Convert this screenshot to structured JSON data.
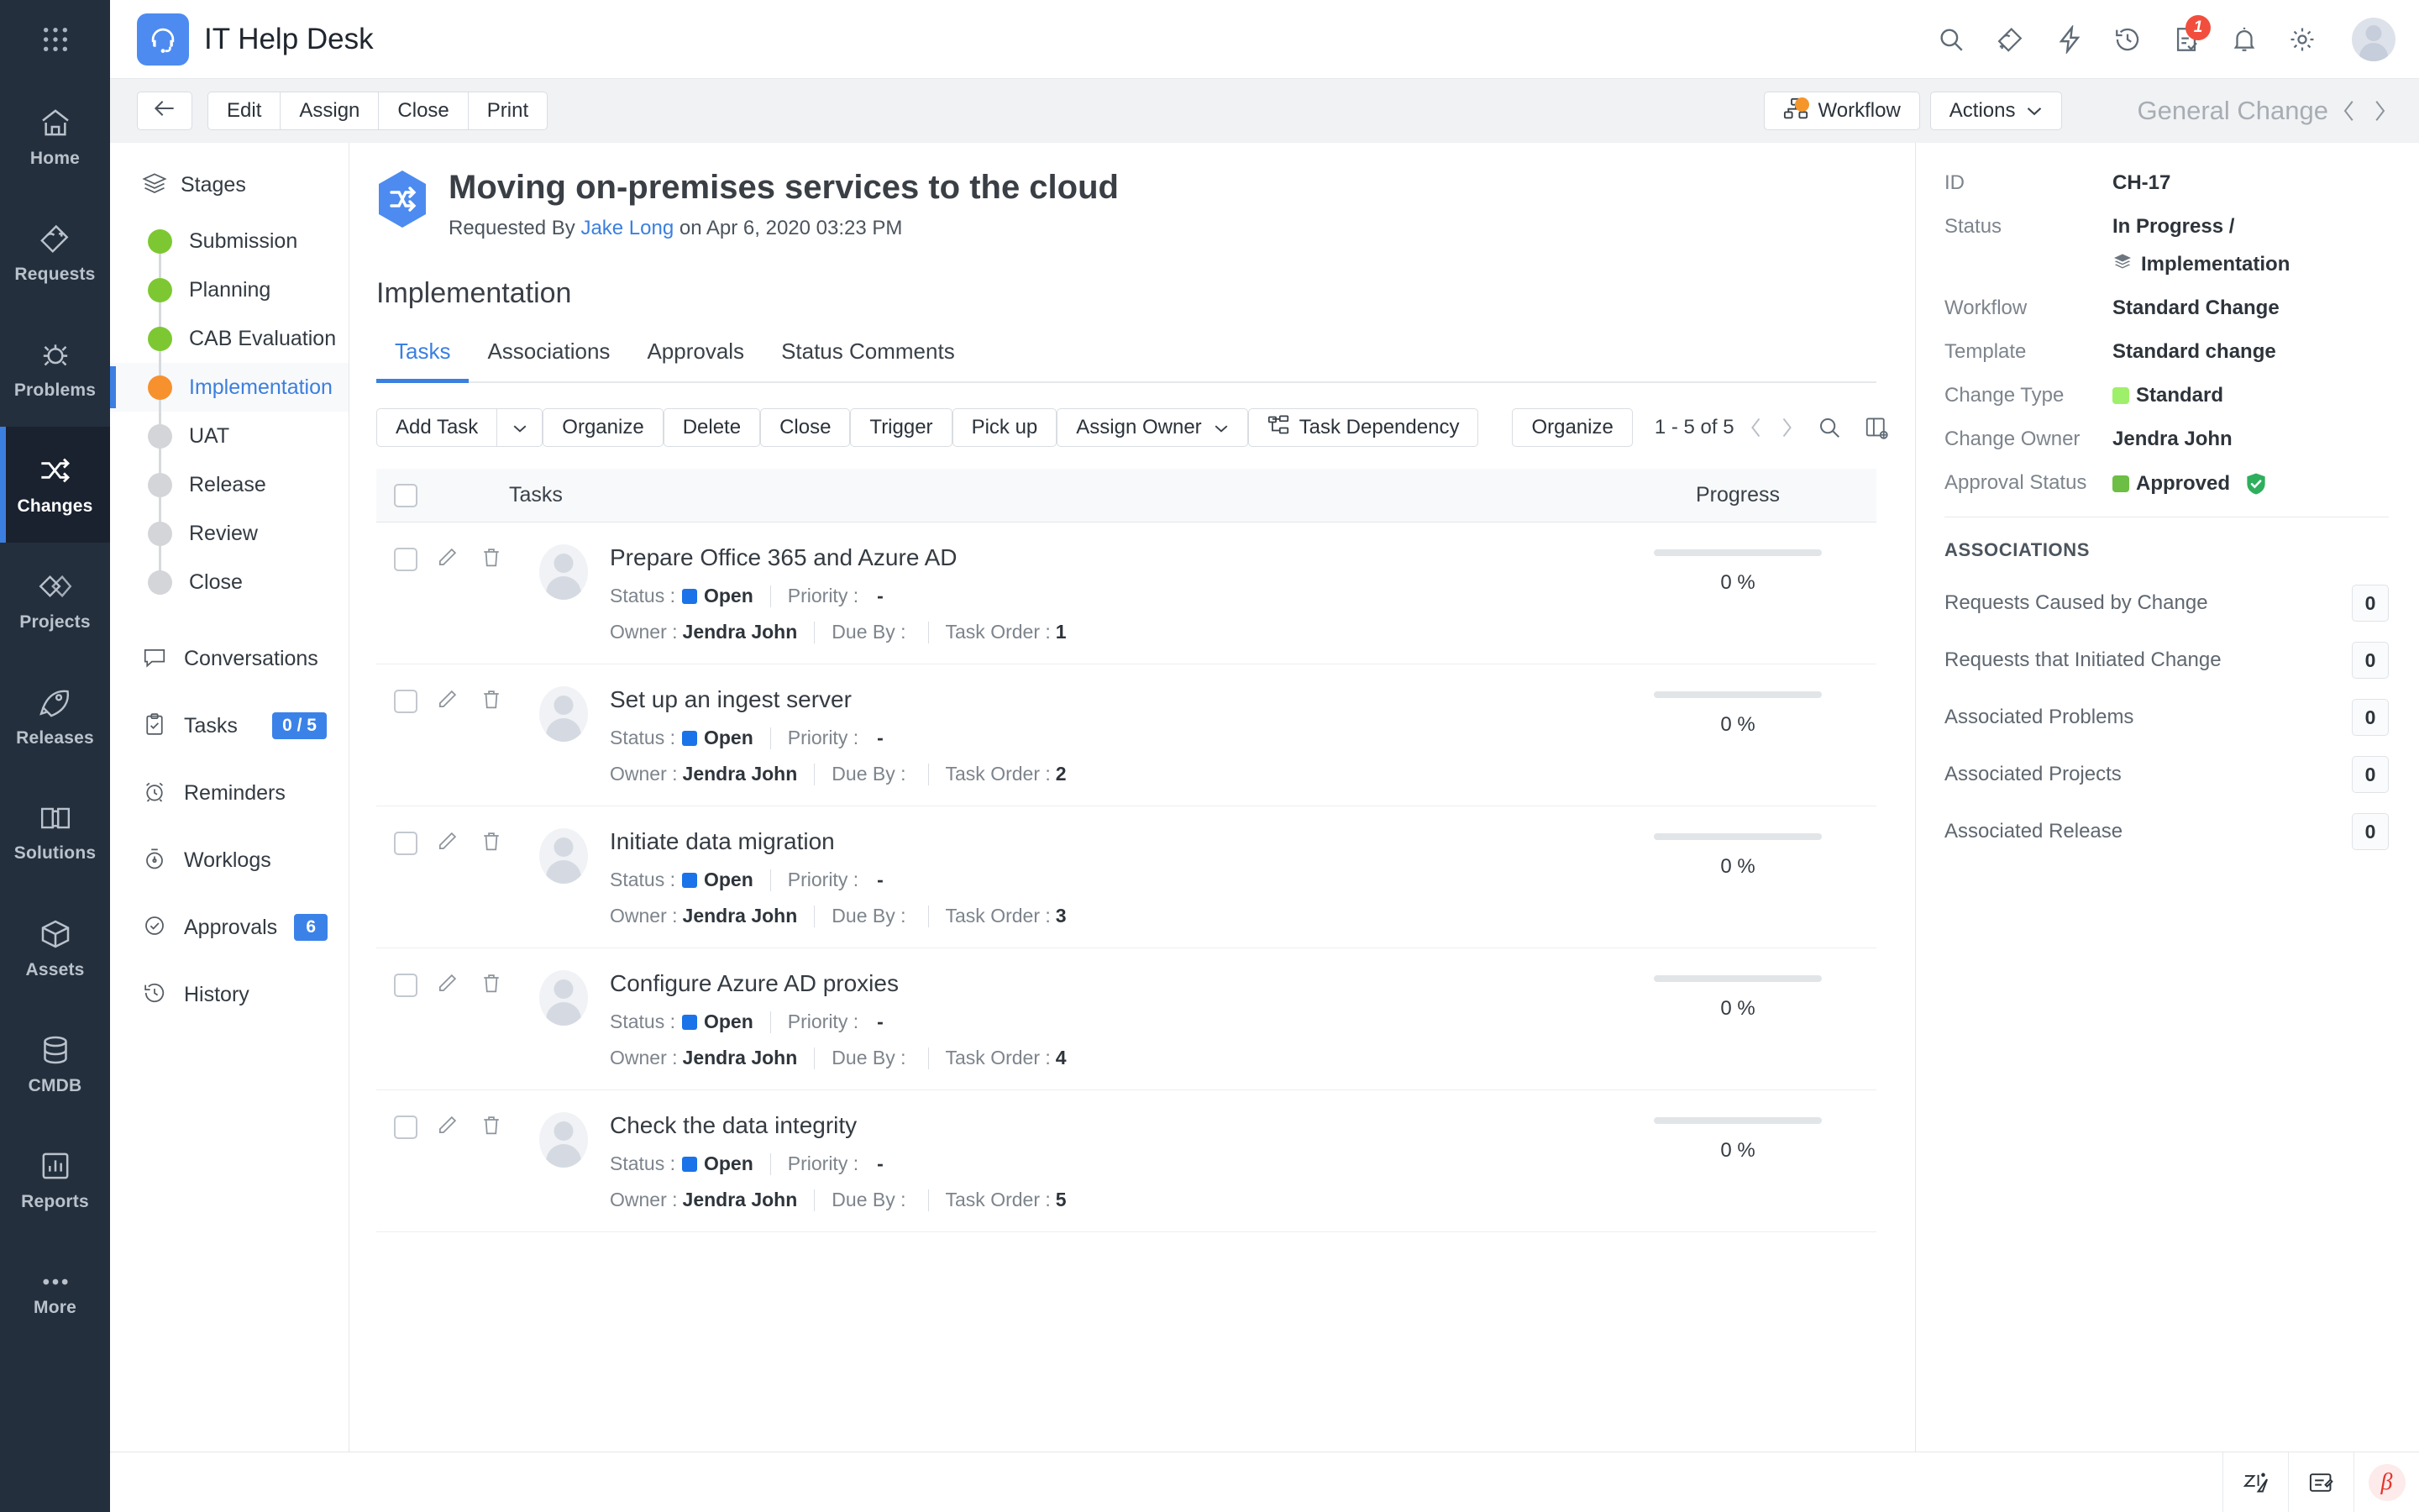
{
  "colors": {
    "accent": "#3b7fe0",
    "rail_bg": "#242f3d",
    "stage_done": "#7dc832",
    "stage_active": "#f6912e",
    "stage_pending": "#d3d5d8",
    "badge_blue": "#3b82e8",
    "badge_red": "#f24e3e",
    "status_open": "#1a73e8",
    "change_type": "#9ef06a",
    "approval": "#6cbe45"
  },
  "rail": {
    "apps_icon": "grid-apps-icon",
    "items": [
      {
        "label": "Home",
        "icon": "home-icon",
        "active": false
      },
      {
        "label": "Requests",
        "icon": "ticket-icon",
        "active": false
      },
      {
        "label": "Problems",
        "icon": "bug-icon",
        "active": false
      },
      {
        "label": "Changes",
        "icon": "changes-icon",
        "active": true
      },
      {
        "label": "Projects",
        "icon": "projects-icon",
        "active": false
      },
      {
        "label": "Releases",
        "icon": "rocket-icon",
        "active": false
      },
      {
        "label": "Solutions",
        "icon": "book-icon",
        "active": false
      },
      {
        "label": "Assets",
        "icon": "cube-icon",
        "active": false
      },
      {
        "label": "CMDB",
        "icon": "database-icon",
        "active": false
      },
      {
        "label": "Reports",
        "icon": "chart-icon",
        "active": false
      },
      {
        "label": "More",
        "icon": "ellipsis-icon",
        "active": false
      }
    ]
  },
  "topbar": {
    "title": "IT Help Desk",
    "logo_icon": "headset-icon",
    "icons": [
      {
        "name": "search-icon",
        "badge": null
      },
      {
        "name": "add-ticket-icon",
        "badge": null
      },
      {
        "name": "quick-actions-icon",
        "badge": null
      },
      {
        "name": "history-icon",
        "badge": null
      },
      {
        "name": "approvals-icon",
        "badge": "1"
      },
      {
        "name": "notifications-bell-icon",
        "badge": null
      },
      {
        "name": "settings-gear-icon",
        "badge": null
      }
    ],
    "avatar": "user-avatar"
  },
  "actionbar": {
    "back_icon": "arrow-left-icon",
    "buttons": [
      "Edit",
      "Assign",
      "Close",
      "Print"
    ],
    "workflow_label": "Workflow",
    "workflow_icon": "workflow-icon",
    "actions_label": "Actions",
    "record_type": "General Change",
    "prev_icon": "chevron-left-icon",
    "next_icon": "chevron-right-icon"
  },
  "detail_panel": {
    "stages_header": "Stages",
    "stages_icon": "layers-icon",
    "stages": [
      {
        "label": "Submission",
        "state": "done"
      },
      {
        "label": "Planning",
        "state": "done"
      },
      {
        "label": "CAB Evaluation",
        "state": "done"
      },
      {
        "label": "Implementation",
        "state": "active"
      },
      {
        "label": "UAT",
        "state": "pending"
      },
      {
        "label": "Release",
        "state": "pending"
      },
      {
        "label": "Review",
        "state": "pending"
      },
      {
        "label": "Close",
        "state": "pending"
      }
    ],
    "items": [
      {
        "label": "Conversations",
        "icon": "chat-icon",
        "badge": null
      },
      {
        "label": "Tasks",
        "icon": "clipboard-check-icon",
        "badge": "0 / 5"
      },
      {
        "label": "Reminders",
        "icon": "alarm-clock-icon",
        "badge": null
      },
      {
        "label": "Worklogs",
        "icon": "stopwatch-icon",
        "badge": null
      },
      {
        "label": "Approvals",
        "icon": "check-circle-icon",
        "badge": "6"
      },
      {
        "label": "History",
        "icon": "history-icon",
        "badge": null
      }
    ]
  },
  "record": {
    "icon": "change-hex-icon",
    "title": "Moving on-premises services to the cloud",
    "requested_by_prefix": "Requested By",
    "requester": "Jake Long",
    "requested_on": "on Apr 6, 2020 03:23 PM",
    "stage_title": "Implementation"
  },
  "tabs": [
    {
      "label": "Tasks",
      "active": true
    },
    {
      "label": "Associations",
      "active": false
    },
    {
      "label": "Approvals",
      "active": false
    },
    {
      "label": "Status Comments",
      "active": false
    }
  ],
  "toolbar": {
    "add_task_label": "Add Task",
    "add_task_caret_icon": "chevron-down-icon",
    "organize_label": "Organize",
    "delete_label": "Delete",
    "close_label": "Close",
    "trigger_label": "Trigger",
    "pickup_label": "Pick up",
    "assign_owner_label": "Assign Owner",
    "assign_owner_caret_icon": "chevron-down-icon",
    "task_dependency_label": "Task Dependency",
    "task_dependency_icon": "dependency-icon",
    "organize2_label": "Organize",
    "pager_text": "1 - 5 of 5",
    "prev_icon": "chevron-left-icon",
    "next_icon": "chevron-right-icon",
    "search_icon": "search-icon",
    "columns_icon": "column-settings-icon"
  },
  "table": {
    "header": {
      "tasks": "Tasks",
      "progress": "Progress"
    },
    "labels": {
      "status": "Status :",
      "priority": "Priority :",
      "owner": "Owner :",
      "due_by": "Due By :",
      "task_order": "Task Order :"
    },
    "rows": [
      {
        "name": "Prepare Office 365 and Azure AD",
        "status": "Open",
        "priority": "-",
        "owner": "Jendra John",
        "due_by": "",
        "task_order": "1",
        "progress": "0 %",
        "progress_value": 0
      },
      {
        "name": "Set up an ingest server",
        "status": "Open",
        "priority": "-",
        "owner": "Jendra John",
        "due_by": "",
        "task_order": "2",
        "progress": "0 %",
        "progress_value": 0
      },
      {
        "name": "Initiate data migration",
        "status": "Open",
        "priority": "-",
        "owner": "Jendra John",
        "due_by": "",
        "task_order": "3",
        "progress": "0 %",
        "progress_value": 0
      },
      {
        "name": "Configure Azure AD proxies",
        "status": "Open",
        "priority": "-",
        "owner": "Jendra John",
        "due_by": "",
        "task_order": "4",
        "progress": "0 %",
        "progress_value": 0
      },
      {
        "name": "Check the data integrity",
        "status": "Open",
        "priority": "-",
        "owner": "Jendra John",
        "due_by": "",
        "task_order": "5",
        "progress": "0 %",
        "progress_value": 0
      }
    ]
  },
  "properties": {
    "id_label": "ID",
    "id_value": "CH-17",
    "status_label": "Status",
    "status_value": "In Progress /",
    "status_stage": "Implementation",
    "workflow_label": "Workflow",
    "workflow_value": "Standard Change",
    "template_label": "Template",
    "template_value": "Standard change",
    "change_type_label": "Change Type",
    "change_type_value": "Standard",
    "change_owner_label": "Change Owner",
    "change_owner_value": "Jendra John",
    "approval_status_label": "Approval Status",
    "approval_status_value": "Approved"
  },
  "associations": {
    "title": "ASSOCIATIONS",
    "collapse_icon": "chevron-double-right-icon",
    "rows": [
      {
        "label": "Requests Caused by Change",
        "count": "0"
      },
      {
        "label": "Requests that Initiated Change",
        "count": "0"
      },
      {
        "label": "Associated Problems",
        "count": "0"
      },
      {
        "label": "Associated Projects",
        "count": "0"
      },
      {
        "label": "Associated Release",
        "count": "0"
      }
    ]
  },
  "bottombar": {
    "icons": [
      {
        "name": "zia-assistant-icon"
      },
      {
        "name": "notes-edit-icon"
      },
      {
        "name": "beta-icon",
        "label": "β"
      }
    ]
  }
}
